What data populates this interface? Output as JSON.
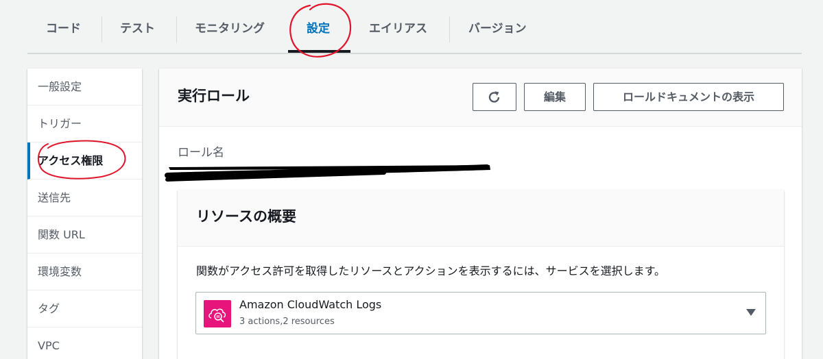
{
  "tabs": [
    {
      "label": "コード"
    },
    {
      "label": "テスト"
    },
    {
      "label": "モニタリング"
    },
    {
      "label": "設定",
      "active": true
    },
    {
      "label": "エイリアス"
    },
    {
      "label": "バージョン"
    }
  ],
  "sidebar": {
    "items": [
      {
        "label": "一般設定"
      },
      {
        "label": "トリガー"
      },
      {
        "label": "アクセス権限",
        "active": true
      },
      {
        "label": "送信先"
      },
      {
        "label": "関数 URL"
      },
      {
        "label": "環境変数"
      },
      {
        "label": "タグ"
      },
      {
        "label": "VPC"
      }
    ]
  },
  "role_panel": {
    "title": "実行ロール",
    "refresh_icon": "refresh-icon",
    "edit_label": "編集",
    "view_doc_label": "ロールドキュメントの表示",
    "role_name_label": "ロール名"
  },
  "resource_summary": {
    "title": "リソースの概要",
    "description": "関数がアクセス許可を取得したリソースとアクションを表示するには、サービスを選択します。",
    "service": {
      "icon": "cloudwatch-logs-icon",
      "name": "Amazon CloudWatch Logs",
      "detail": "3 actions,2 resources"
    }
  },
  "colors": {
    "accent": "#0073bb",
    "annotation": "#e0142a",
    "service_icon_bg": "#e7157b"
  }
}
